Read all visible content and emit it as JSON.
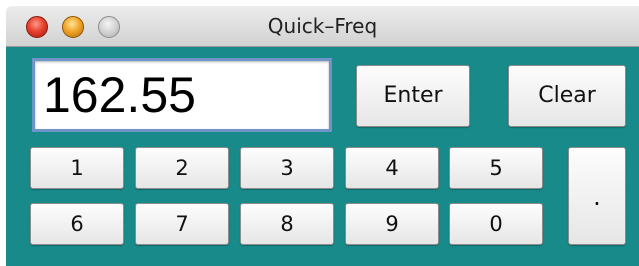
{
  "window": {
    "title": "Quick–Freq"
  },
  "display": {
    "value": "162.55"
  },
  "actions": {
    "enter_label": "Enter",
    "clear_label": "Clear"
  },
  "keypad": {
    "row1": [
      "1",
      "2",
      "3",
      "4",
      "5"
    ],
    "row2": [
      "6",
      "7",
      "8",
      "9",
      "0"
    ],
    "dot_label": "."
  },
  "colors": {
    "background": "#178a89",
    "display_border": "#6f95c8",
    "close": "#e8412e",
    "minimize": "#f2a62a",
    "zoom": "#cfcfcf"
  },
  "icons": {
    "close": "close-traffic-light-icon",
    "minimize": "minimize-traffic-light-icon",
    "zoom": "zoom-traffic-light-icon"
  }
}
